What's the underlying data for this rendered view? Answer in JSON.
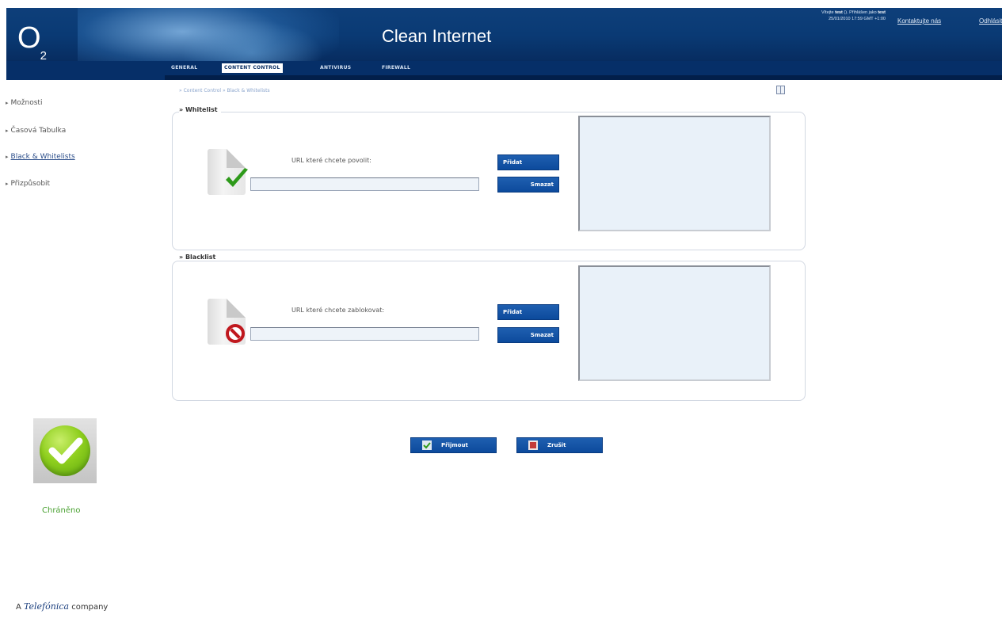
{
  "header": {
    "logo": "O",
    "logo_sub": "2",
    "title": "Clean Internet",
    "user_info_line1_prefix": "Vítejte ",
    "user_info_user": "test",
    "user_info_line1_mid": " (). Přihlášen jako ",
    "user_info_user2": "test",
    "user_info_line2": "25/01/2010 17:59 GMT +1:00",
    "contact_link": "Kontaktujte nás",
    "logout_link": "Odhlásit"
  },
  "nav": {
    "tabs": [
      "GENERAL",
      "CONTENT CONTROL",
      "ANTIVIRUS",
      "FIREWALL"
    ],
    "active_tab": "CONTENT CONTROL"
  },
  "sidebar": {
    "items": [
      {
        "label": "Možnosti"
      },
      {
        "label": "Časová Tabulka"
      },
      {
        "label": "Black & Whitelists"
      },
      {
        "label": "Přizpůsobit"
      }
    ],
    "current": "Black & Whitelists"
  },
  "breadcrumb": "» Content Control » Black & Whitelists",
  "whitelist": {
    "legend": "» Whitelist",
    "field_label": "URL které chcete povolit:",
    "input_value": "",
    "add_button": "Přidat",
    "delete_button": "Smazat"
  },
  "blacklist": {
    "legend": "» Blacklist",
    "field_label": "URL které chcete zablokovat:",
    "input_value": "",
    "add_button": "Přidat",
    "delete_button": "Smazat"
  },
  "actions": {
    "accept": "Přijmout",
    "cancel": "Zrušit"
  },
  "status": {
    "text": "Chráněno"
  },
  "footer": {
    "prefix": "A",
    "brand": "Telefónica",
    "suffix": "company"
  },
  "colors": {
    "header_bg": "#0a3a74",
    "nav_bg": "#062f68",
    "button_bg": "#0c4a9c",
    "list_bg": "#e9f1f9",
    "status_green": "#4aa132"
  },
  "icons": [
    "help-icon",
    "check-icon",
    "no-entry-icon",
    "accept-icon",
    "cancel-icon",
    "protected-check-icon"
  ]
}
